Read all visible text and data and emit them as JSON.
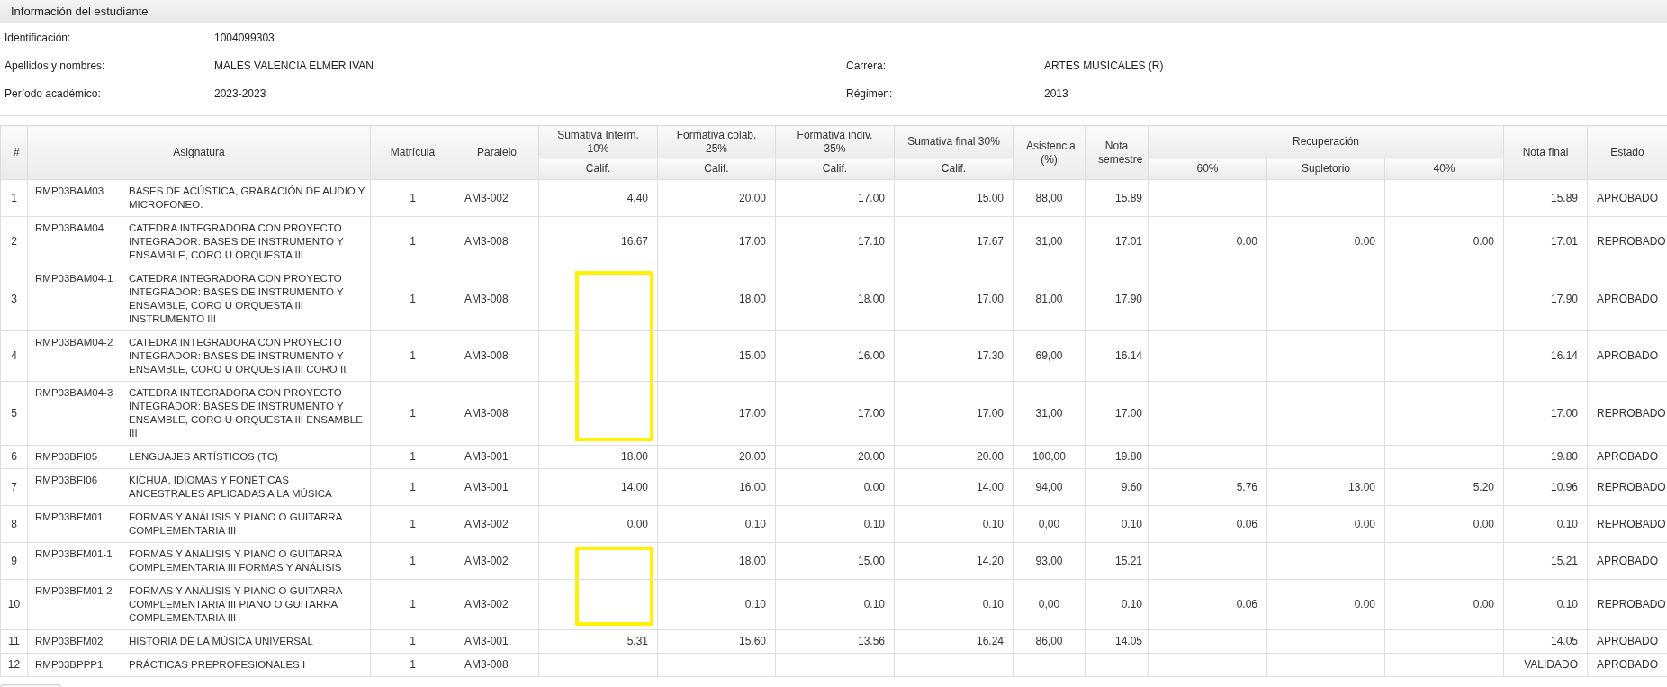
{
  "panel": {
    "title": "Información del estudiante"
  },
  "student": [
    {
      "label": "Identificación:",
      "value": "1004099303"
    },
    {
      "label": "Apellidos y nombres:",
      "value": "MALES VALENCIA ELMER IVAN",
      "label_2": "Carrera:",
      "value_2": "ARTES MUSICALES (R)"
    },
    {
      "label": "Período académico:",
      "value": "2023-2023",
      "label_2": "Régimen:",
      "value_2": "2013"
    }
  ],
  "table": {
    "columns": {
      "num": "#",
      "asignatura": "Asignatura",
      "matricula": "Matrícula",
      "paralelo": "Paralelo",
      "sumativa_interm": "Sumativa Interm. 10%",
      "formativa_colab": "Formativa colab. 25%",
      "formativa_indiv": "Formativa indiv. 35%",
      "sumativa_final": "Sumativa final 30%",
      "asistencia": "Asistencia (%)",
      "nota_semestre": "Nota semestre",
      "recuperacion": "Recuperación",
      "nota_final": "Nota final",
      "estado": "Estado"
    },
    "sub_columns": {
      "calif": [
        "Calif.",
        "Calif.",
        "Calif.",
        "Calif."
      ],
      "recuperacion": [
        "60%",
        "Supletorio",
        "40%"
      ]
    },
    "rows": [
      {
        "num": "1",
        "code": "RMP03BAM03",
        "name": "BASES DE ACÚSTICA, GRABACIÓN DE AUDIO Y MICROFONEO.",
        "matricula": "1",
        "paralelo": "AM3-002",
        "sumativa_interm": "4.40",
        "formativa_colab": "20.00",
        "formativa_indiv": "17.00",
        "sumativa_final": "15.00",
        "highlighted": false,
        "asistencia": "88,00",
        "nota_semestre": "15.89",
        "nota_final": "15.89",
        "estado": "APROBADO"
      },
      {
        "num": "2",
        "code": "RMP03BAM04",
        "name": "CATEDRA INTEGRADORA CON PROYECTO INTEGRADOR: BASES DE INSTRUMENTO Y ENSAMBLE, CORO U ORQUESTA III",
        "matricula": "1",
        "paralelo": "AM3-008",
        "sumativa_interm": "16.67",
        "formativa_colab": "17.00",
        "formativa_indiv": "17.10",
        "sumativa_final": "17.67",
        "highlighted": false,
        "asistencia": "31,00",
        "nota_semestre": "17.01",
        "rec_60": "0.00",
        "supletorio": "0.00",
        "rec_40": "0.00",
        "nota_final": "17.01",
        "estado": "REPROBADO"
      },
      {
        "num": "3",
        "code": "RMP03BAM04-1",
        "name": "CATEDRA INTEGRADORA CON PROYECTO INTEGRADOR: BASES DE INSTRUMENTO Y ENSAMBLE, CORO U ORQUESTA III INSTRUMENTO III",
        "matricula": "1",
        "paralelo": "AM3-008",
        "formativa_colab": "18.00",
        "formativa_indiv": "18.00",
        "sumativa_final": "17.00",
        "highlighted": true,
        "asistencia": "81,00",
        "nota_semestre": "17.90",
        "nota_final": "17.90",
        "estado": "APROBADO"
      },
      {
        "num": "4",
        "code": "RMP03BAM04-2",
        "name": "CATEDRA INTEGRADORA CON PROYECTO INTEGRADOR: BASES DE INSTRUMENTO Y ENSAMBLE, CORO U ORQUESTA III CORO II",
        "matricula": "1",
        "paralelo": "AM3-008",
        "formativa_colab": "15.00",
        "formativa_indiv": "16.00",
        "sumativa_final": "17.30",
        "highlighted": true,
        "asistencia": "69,00",
        "nota_semestre": "16.14",
        "nota_final": "16.14",
        "estado": "APROBADO"
      },
      {
        "num": "5",
        "code": "RMP03BAM04-3",
        "name": "CATEDRA INTEGRADORA CON PROYECTO INTEGRADOR: BASES DE INSTRUMENTO Y ENSAMBLE, CORO U ORQUESTA III ENSAMBLE III",
        "matricula": "1",
        "paralelo": "AM3-008",
        "formativa_colab": "17.00",
        "formativa_indiv": "17.00",
        "sumativa_final": "17.00",
        "highlighted": true,
        "asistencia": "31,00",
        "nota_semestre": "17.00",
        "nota_final": "17.00",
        "estado": "REPROBADO"
      },
      {
        "num": "6",
        "code": "RMP03BFI05",
        "name": "LENGUAJES ARTÍSTICOS (TC)",
        "matricula": "1",
        "paralelo": "AM3-001",
        "sumativa_interm": "18.00",
        "formativa_colab": "20.00",
        "formativa_indiv": "20.00",
        "sumativa_final": "20.00",
        "highlighted": false,
        "asistencia": "100,00",
        "nota_semestre": "19.80",
        "nota_final": "19.80",
        "estado": "APROBADO"
      },
      {
        "num": "7",
        "code": "RMP03BFI06",
        "name": "KICHUA, IDIOMAS Y FONÉTICAS ANCESTRALES APLICADAS A LA MÚSICA",
        "matricula": "1",
        "paralelo": "AM3-001",
        "sumativa_interm": "14.00",
        "formativa_colab": "16.00",
        "formativa_indiv": "0.00",
        "sumativa_final": "14.00",
        "highlighted": false,
        "asistencia": "94,00",
        "nota_semestre": "9.60",
        "rec_60": "5.76",
        "supletorio": "13.00",
        "rec_40": "5.20",
        "nota_final": "10.96",
        "estado": "REPROBADO"
      },
      {
        "num": "8",
        "code": "RMP03BFM01",
        "name": "FORMAS Y ANÁLISIS Y PIANO O GUITARRA COMPLEMENTARIA III",
        "matricula": "1",
        "paralelo": "AM3-002",
        "sumativa_interm": "0.00",
        "formativa_colab": "0.10",
        "formativa_indiv": "0.10",
        "sumativa_final": "0.10",
        "highlighted": false,
        "asistencia": "0,00",
        "nota_semestre": "0.10",
        "rec_60": "0.06",
        "supletorio": "0.00",
        "rec_40": "0.00",
        "nota_final": "0.10",
        "estado": "REPROBADO"
      },
      {
        "num": "9",
        "code": "RMP03BFM01-1",
        "name": "FORMAS Y ANÁLISIS Y PIANO O GUITARRA COMPLEMENTARIA III FORMAS Y ANÁLISIS",
        "matricula": "1",
        "paralelo": "AM3-002",
        "formativa_colab": "18.00",
        "formativa_indiv": "15.00",
        "sumativa_final": "14.20",
        "highlighted": true,
        "asistencia": "93,00",
        "nota_semestre": "15.21",
        "nota_final": "15.21",
        "estado": "APROBADO"
      },
      {
        "num": "10",
        "code": "RMP03BFM01-2",
        "name": "FORMAS Y ANÁLISIS Y PIANO O GUITARRA COMPLEMENTARIA III PIANO O GUITARRA COMPLEMENTARIA III",
        "matricula": "1",
        "paralelo": "AM3-002",
        "formativa_colab": "0.10",
        "formativa_indiv": "0.10",
        "sumativa_final": "0.10",
        "highlighted": true,
        "asistencia": "0,00",
        "nota_semestre": "0.10",
        "rec_60": "0.06",
        "supletorio": "0.00",
        "rec_40": "0.00",
        "nota_final": "0.10",
        "estado": "REPROBADO"
      },
      {
        "num": "11",
        "code": "RMP03BFM02",
        "name": "HISTORIA DE LA MÚSICA UNIVERSAL",
        "matricula": "1",
        "paralelo": "AM3-001",
        "sumativa_interm": "5.31",
        "formativa_colab": "15.60",
        "formativa_indiv": "13.56",
        "sumativa_final": "16.24",
        "highlighted": false,
        "asistencia": "86,00",
        "nota_semestre": "14.05",
        "nota_final": "14.05",
        "estado": "APROBADO"
      },
      {
        "num": "12",
        "code": "RMP03BPPP1",
        "name": "PRÁCTICAS PREPROFESIONALES I",
        "matricula": "1",
        "paralelo": "AM3-008",
        "highlighted": false,
        "nota_final": "VALIDADO",
        "estado": "APROBADO"
      }
    ]
  }
}
